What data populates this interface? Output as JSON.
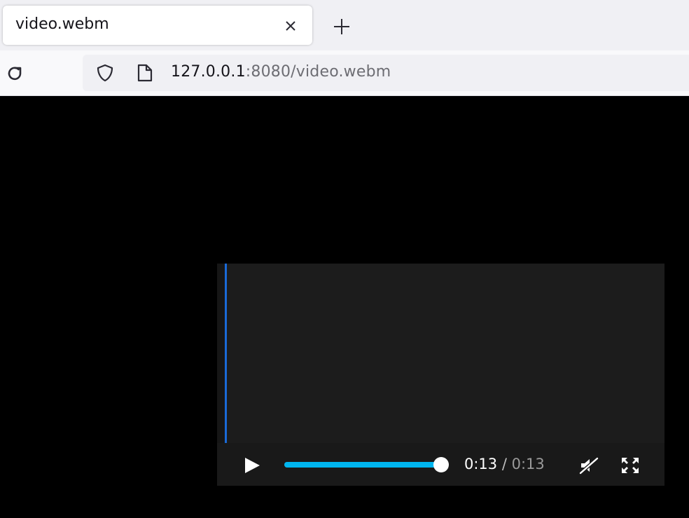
{
  "browser": {
    "tab": {
      "title": "video.webm"
    },
    "url": {
      "host": "127.0.0.1",
      "rest": ":8080/video.webm"
    }
  },
  "video": {
    "current_time": "0:13",
    "separator": "/",
    "duration": "0:13",
    "progress_fraction": 1.0,
    "muted": true
  },
  "colors": {
    "accent": "#00b6f0",
    "frame_edge": "#1a6ad8",
    "background": "#000000"
  },
  "icons": [
    "close-icon",
    "plus-icon",
    "reload-icon",
    "shield-icon",
    "page-icon",
    "play-icon",
    "mute-icon",
    "fullscreen-icon"
  ]
}
